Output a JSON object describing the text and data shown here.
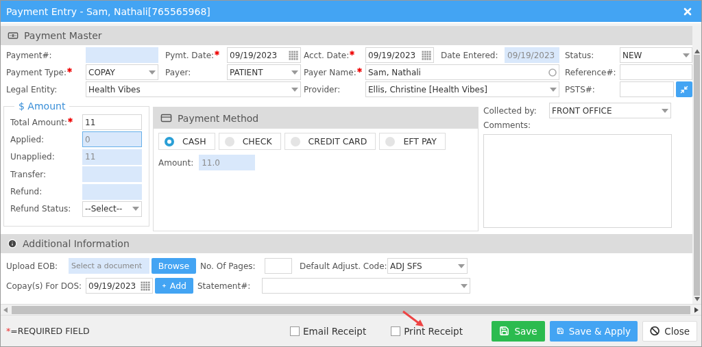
{
  "window": {
    "title": "Payment Entry - Sam, Nathali[765565968]"
  },
  "payment_master": {
    "title": "Payment Master",
    "fields": [
      {
        "label": "Payment#:",
        "required": false,
        "kind": "readonly"
      },
      {
        "label": "Pymt. Date:",
        "required": true,
        "kind": "date",
        "value": "09/19/2023"
      },
      {
        "label": "Acct. Date:",
        "required": true,
        "kind": "date",
        "value": "09/19/2023"
      },
      {
        "label": "Date Entered:",
        "required": false,
        "kind": "readonly",
        "value": "09/19/2023"
      },
      {
        "label": "Status:",
        "required": false,
        "kind": "select",
        "value": "NEW"
      },
      {
        "label": "Payment Type:",
        "required": true,
        "kind": "select",
        "value": "COPAY"
      },
      {
        "label": "Payer:",
        "required": false,
        "kind": "select",
        "value": "PATIENT"
      },
      {
        "label": "Payer Name:",
        "required": true,
        "kind": "lookup",
        "value": "Sam, Nathali"
      },
      {
        "label": "Reference#:",
        "required": false,
        "kind": "text"
      },
      {
        "label": "Legal Entity:",
        "required": false,
        "kind": "select",
        "value": "Health Vibes"
      },
      {
        "label": "Provider:",
        "required": false,
        "kind": "select",
        "value": "Ellis, Christine [Health Vibes]"
      },
      {
        "label": "PSTS#:",
        "required": false,
        "kind": "text_button"
      }
    ]
  },
  "amount": {
    "legend": "$ Amount",
    "fields": [
      {
        "label": "Total Amount:",
        "required": true,
        "kind": "text",
        "value": "11"
      },
      {
        "label": "Applied:",
        "required": false,
        "kind": "readonly",
        "value": "0",
        "focused": true
      },
      {
        "label": "Unapplied:",
        "required": false,
        "kind": "readonly",
        "value": "11"
      },
      {
        "label": "Transfer:",
        "required": false,
        "kind": "readonly"
      },
      {
        "label": "Refund:",
        "required": false,
        "kind": "readonly"
      },
      {
        "label": "Refund Status:",
        "required": false,
        "kind": "select",
        "value": "--Select--"
      }
    ]
  },
  "payment_method": {
    "title": "Payment Method",
    "options": [
      {
        "label": "CASH",
        "selected": true
      },
      {
        "label": "CHECK",
        "selected": false
      },
      {
        "label": "CREDIT CARD",
        "selected": false
      },
      {
        "label": "EFT PAY",
        "selected": false
      }
    ],
    "amount_label": "Amount:",
    "amount_value": "11.0"
  },
  "collection": {
    "collected_by_label": "Collected by:",
    "collected_by": "FRONT OFFICE",
    "comments_label": "Comments:"
  },
  "additional_information": {
    "title": "Additional Information",
    "upload_eob_label": "Upload EOB:",
    "upload_placeholder": "Select a document",
    "browse_button": "Browse",
    "pages_label": "No. Of Pages:",
    "adjust_code_label": "Default Adjust. Code:",
    "adjust_code": "ADJ SFS",
    "copay_dos_label": "Copay(s) For DOS:",
    "copay_dos": "09/19/2023",
    "add_button": "Add",
    "statement_label": "Statement#:"
  },
  "footer": {
    "required_marker": "*",
    "required_note": "=REQUIRED FIELD",
    "checkboxes": [
      {
        "label": "Email Receipt",
        "checked": false
      },
      {
        "label": "Print Receipt",
        "checked": false
      }
    ],
    "buttons": [
      {
        "label": "Save",
        "kind": "save"
      },
      {
        "label": "Save & Apply",
        "kind": "apply"
      },
      {
        "label": "Close",
        "kind": "close"
      }
    ]
  }
}
